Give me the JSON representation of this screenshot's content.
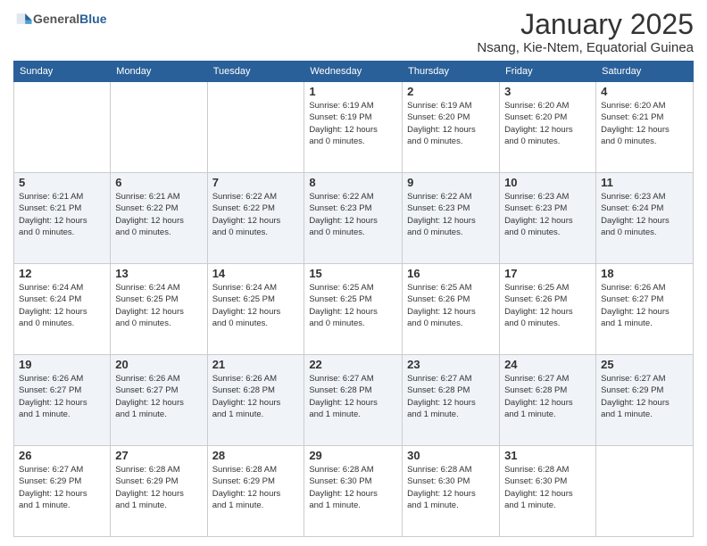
{
  "header": {
    "logo_general": "General",
    "logo_blue": "Blue",
    "month_title": "January 2025",
    "location": "Nsang, Kie-Ntem, Equatorial Guinea"
  },
  "weekdays": [
    "Sunday",
    "Monday",
    "Tuesday",
    "Wednesday",
    "Thursday",
    "Friday",
    "Saturday"
  ],
  "weeks": [
    [
      {
        "day": "",
        "info": ""
      },
      {
        "day": "",
        "info": ""
      },
      {
        "day": "",
        "info": ""
      },
      {
        "day": "1",
        "info": "Sunrise: 6:19 AM\nSunset: 6:19 PM\nDaylight: 12 hours\nand 0 minutes."
      },
      {
        "day": "2",
        "info": "Sunrise: 6:19 AM\nSunset: 6:20 PM\nDaylight: 12 hours\nand 0 minutes."
      },
      {
        "day": "3",
        "info": "Sunrise: 6:20 AM\nSunset: 6:20 PM\nDaylight: 12 hours\nand 0 minutes."
      },
      {
        "day": "4",
        "info": "Sunrise: 6:20 AM\nSunset: 6:21 PM\nDaylight: 12 hours\nand 0 minutes."
      }
    ],
    [
      {
        "day": "5",
        "info": "Sunrise: 6:21 AM\nSunset: 6:21 PM\nDaylight: 12 hours\nand 0 minutes."
      },
      {
        "day": "6",
        "info": "Sunrise: 6:21 AM\nSunset: 6:22 PM\nDaylight: 12 hours\nand 0 minutes."
      },
      {
        "day": "7",
        "info": "Sunrise: 6:22 AM\nSunset: 6:22 PM\nDaylight: 12 hours\nand 0 minutes."
      },
      {
        "day": "8",
        "info": "Sunrise: 6:22 AM\nSunset: 6:23 PM\nDaylight: 12 hours\nand 0 minutes."
      },
      {
        "day": "9",
        "info": "Sunrise: 6:22 AM\nSunset: 6:23 PM\nDaylight: 12 hours\nand 0 minutes."
      },
      {
        "day": "10",
        "info": "Sunrise: 6:23 AM\nSunset: 6:23 PM\nDaylight: 12 hours\nand 0 minutes."
      },
      {
        "day": "11",
        "info": "Sunrise: 6:23 AM\nSunset: 6:24 PM\nDaylight: 12 hours\nand 0 minutes."
      }
    ],
    [
      {
        "day": "12",
        "info": "Sunrise: 6:24 AM\nSunset: 6:24 PM\nDaylight: 12 hours\nand 0 minutes."
      },
      {
        "day": "13",
        "info": "Sunrise: 6:24 AM\nSunset: 6:25 PM\nDaylight: 12 hours\nand 0 minutes."
      },
      {
        "day": "14",
        "info": "Sunrise: 6:24 AM\nSunset: 6:25 PM\nDaylight: 12 hours\nand 0 minutes."
      },
      {
        "day": "15",
        "info": "Sunrise: 6:25 AM\nSunset: 6:25 PM\nDaylight: 12 hours\nand 0 minutes."
      },
      {
        "day": "16",
        "info": "Sunrise: 6:25 AM\nSunset: 6:26 PM\nDaylight: 12 hours\nand 0 minutes."
      },
      {
        "day": "17",
        "info": "Sunrise: 6:25 AM\nSunset: 6:26 PM\nDaylight: 12 hours\nand 0 minutes."
      },
      {
        "day": "18",
        "info": "Sunrise: 6:26 AM\nSunset: 6:27 PM\nDaylight: 12 hours\nand 1 minute."
      }
    ],
    [
      {
        "day": "19",
        "info": "Sunrise: 6:26 AM\nSunset: 6:27 PM\nDaylight: 12 hours\nand 1 minute."
      },
      {
        "day": "20",
        "info": "Sunrise: 6:26 AM\nSunset: 6:27 PM\nDaylight: 12 hours\nand 1 minute."
      },
      {
        "day": "21",
        "info": "Sunrise: 6:26 AM\nSunset: 6:28 PM\nDaylight: 12 hours\nand 1 minute."
      },
      {
        "day": "22",
        "info": "Sunrise: 6:27 AM\nSunset: 6:28 PM\nDaylight: 12 hours\nand 1 minute."
      },
      {
        "day": "23",
        "info": "Sunrise: 6:27 AM\nSunset: 6:28 PM\nDaylight: 12 hours\nand 1 minute."
      },
      {
        "day": "24",
        "info": "Sunrise: 6:27 AM\nSunset: 6:28 PM\nDaylight: 12 hours\nand 1 minute."
      },
      {
        "day": "25",
        "info": "Sunrise: 6:27 AM\nSunset: 6:29 PM\nDaylight: 12 hours\nand 1 minute."
      }
    ],
    [
      {
        "day": "26",
        "info": "Sunrise: 6:27 AM\nSunset: 6:29 PM\nDaylight: 12 hours\nand 1 minute."
      },
      {
        "day": "27",
        "info": "Sunrise: 6:28 AM\nSunset: 6:29 PM\nDaylight: 12 hours\nand 1 minute."
      },
      {
        "day": "28",
        "info": "Sunrise: 6:28 AM\nSunset: 6:29 PM\nDaylight: 12 hours\nand 1 minute."
      },
      {
        "day": "29",
        "info": "Sunrise: 6:28 AM\nSunset: 6:30 PM\nDaylight: 12 hours\nand 1 minute."
      },
      {
        "day": "30",
        "info": "Sunrise: 6:28 AM\nSunset: 6:30 PM\nDaylight: 12 hours\nand 1 minute."
      },
      {
        "day": "31",
        "info": "Sunrise: 6:28 AM\nSunset: 6:30 PM\nDaylight: 12 hours\nand 1 minute."
      },
      {
        "day": "",
        "info": ""
      }
    ]
  ]
}
